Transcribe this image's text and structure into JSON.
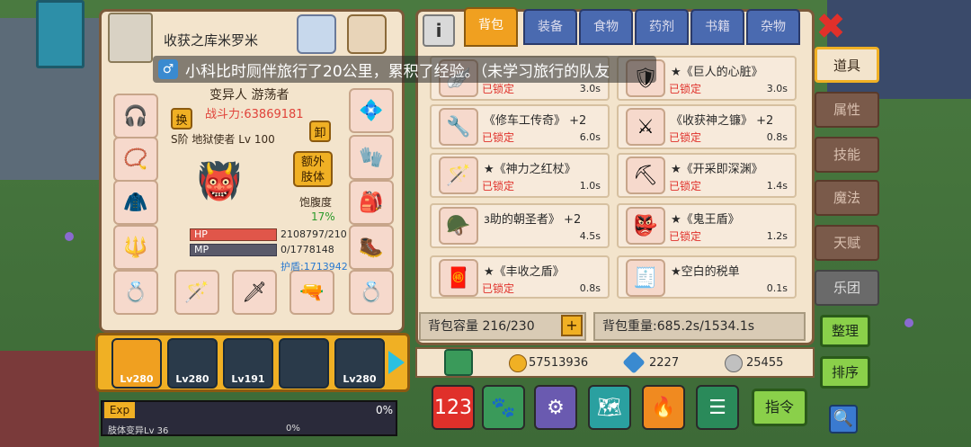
{
  "character": {
    "title": "收获之库米罗米",
    "race": "变异人 游荡者",
    "power": "战斗力:63869181",
    "swap_label": "换",
    "unequip_label": "卸",
    "rank": "S阶 地狱使者 Lv 100",
    "extra_limb_label": "额外\n肢体",
    "fullness_label": "饱腹度",
    "fullness_value": "17%",
    "hp_label": "HP",
    "mp_label": "MP",
    "hp_value": "2108797/210",
    "mp_value": "0/1778148",
    "shield_value": "护盾:1713942"
  },
  "notification": {
    "text": "小科比时厕伴旅行了20公里，累积了经验。（未学习旅行的队友"
  },
  "party": {
    "members": [
      {
        "level": "Lv280"
      },
      {
        "level": "Lv280"
      },
      {
        "level": "Lv191"
      },
      {
        "level": ""
      },
      {
        "level": "Lv280"
      }
    ],
    "exp_label": "Exp",
    "exp_percent": "0%",
    "sub_label": "肢体变异Lv 36",
    "sub_percent": "0%"
  },
  "inventory": {
    "info_label": "i",
    "tabs": [
      "背包",
      "装备",
      "食物",
      "药剂",
      "书籍",
      "杂物"
    ],
    "active_tab": "背包",
    "items": [
      {
        "name": "",
        "locked": "已锁定",
        "weight": "3.0s"
      },
      {
        "name": "★《巨人的心脏》",
        "locked": "已锁定",
        "weight": "3.0s"
      },
      {
        "name": "《修车工传奇》 +2",
        "locked": "已锁定",
        "weight": "6.0s"
      },
      {
        "name": "《收获神之镰》 +2",
        "locked": "已锁定",
        "weight": "0.8s"
      },
      {
        "name": "★《神力之红杖》",
        "locked": "已锁定",
        "weight": "1.0s"
      },
      {
        "name": "★《开采即深渊》",
        "locked": "已锁定",
        "weight": "1.4s"
      },
      {
        "name": "з助的朝圣者》 +2",
        "locked": "",
        "weight": "4.5s"
      },
      {
        "name": "★《鬼王盾》",
        "locked": "已锁定",
        "weight": "1.2s"
      },
      {
        "name": "★《丰收之盾》",
        "locked": "已锁定",
        "weight": "0.8s"
      },
      {
        "name": "★空白的税单",
        "locked": "",
        "weight": "0.1s"
      }
    ],
    "capacity": "背包容量 216/230",
    "capacity_plus": "+",
    "weight": "背包重量:685.2s/1534.1s",
    "gold": "57513936",
    "diamonds": "2227",
    "silver": "25455",
    "command_label": "指令"
  },
  "side_menu": {
    "items": [
      "道具",
      "属性",
      "技能",
      "魔法",
      "天赋",
      "乐团"
    ],
    "active": "道具",
    "organize_label": "整理",
    "sort_label": "排序"
  },
  "colors": {
    "panel_bg": "#f3e4cc",
    "tab_active": "#f0a020",
    "tab_inactive": "#4a6ab0",
    "locked_red": "#e0302a",
    "button_green": "#8ad04a"
  }
}
